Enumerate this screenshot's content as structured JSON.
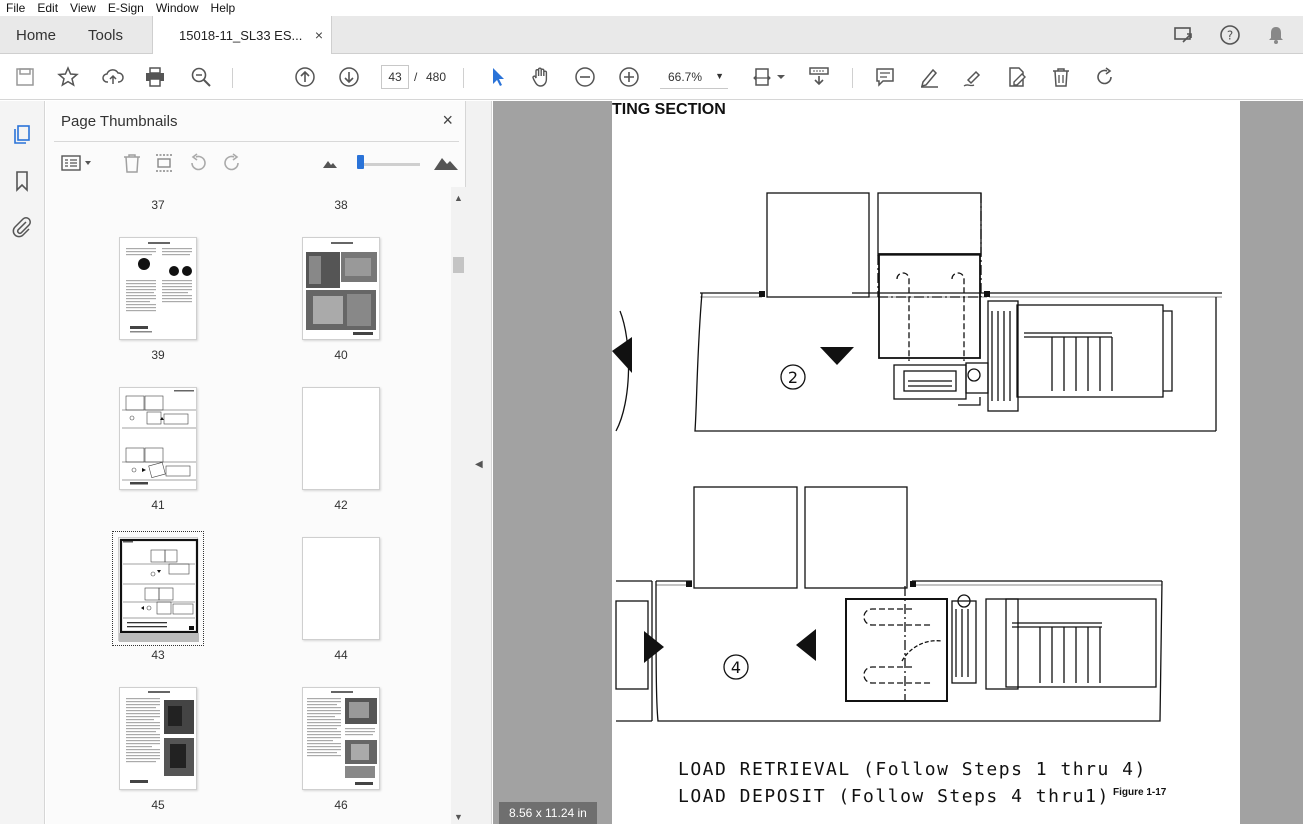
{
  "menu": [
    "File",
    "Edit",
    "View",
    "E-Sign",
    "Window",
    "Help"
  ],
  "tabs": {
    "home": "Home",
    "tools": "Tools",
    "document": "15018-11_SL33 ES...",
    "close": "×"
  },
  "toolbar": {
    "current_page": "43",
    "page_separator": "/",
    "total_pages": "480",
    "zoom": "66.7%"
  },
  "panel": {
    "title": "Page Thumbnails",
    "close": "×",
    "top_labels": [
      "37",
      "38"
    ],
    "thumbnails": [
      {
        "label": "39"
      },
      {
        "label": "40"
      },
      {
        "label": "41"
      },
      {
        "label": "42"
      },
      {
        "label": "43",
        "selected": true
      },
      {
        "label": "44"
      },
      {
        "label": "45"
      },
      {
        "label": "46"
      }
    ]
  },
  "document": {
    "heading": "TING SECTION",
    "step_upper": "2",
    "step_lower": "4",
    "line1": "LOAD  RETRIEVAL  (Follow  Steps 1 thru 4)",
    "line2": "LOAD  DEPOSIT  (Follow  Steps 4 thru1)",
    "figure_label": "Figure 1-17",
    "page_size": "8.56 x 11.24 in"
  },
  "colors": {
    "accent": "#2a73d8",
    "doc_bg": "#a2a2a2",
    "tab_bg": "#e9e9e9"
  }
}
